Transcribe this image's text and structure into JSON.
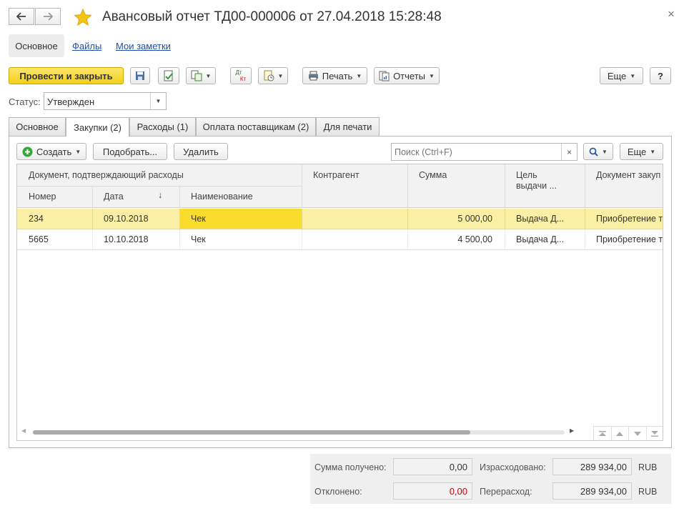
{
  "window": {
    "title": "Авансовый отчет ТД00-000006 от 27.04.2018 15:28:48",
    "close_glyph": "×"
  },
  "nav_links": {
    "main": "Основное",
    "files": "Файлы",
    "notes": "Мои заметки"
  },
  "toolbar": {
    "post_close": "Провести и закрыть",
    "print": "Печать",
    "reports": "Отчеты",
    "more": "Еще",
    "help": "?",
    "dtkt_top": "Дт",
    "dtkt_bottom": "Кт"
  },
  "status": {
    "label": "Статус:",
    "value": "Утвержден"
  },
  "tabs": [
    {
      "label": "Основное"
    },
    {
      "label": "Закупки (2)"
    },
    {
      "label": "Расходы (1)"
    },
    {
      "label": "Оплата поставщикам (2)"
    },
    {
      "label": "Для печати"
    }
  ],
  "table_toolbar": {
    "create": "Создать",
    "pick": "Подобрать...",
    "delete": "Удалить",
    "search_placeholder": "Поиск (Ctrl+F)",
    "more": "Еще"
  },
  "table": {
    "group_header": "Документ, подтверждающий расходы",
    "columns": {
      "number": "Номер",
      "date": "Дата",
      "name": "Наименование",
      "counterparty": "Контрагент",
      "sum": "Сумма",
      "purpose": "Цель выдачи ...",
      "purchase_doc": "Документ закуп"
    },
    "sort_indicator": "↓",
    "rows": [
      {
        "number": "234",
        "date": "09.10.2018",
        "name": "Чек",
        "counterparty": "",
        "sum": "5 000,00",
        "purpose": "Выдача Д...",
        "purchase_doc": "Приобретение т"
      },
      {
        "number": "5665",
        "date": "10.10.2018",
        "name": "Чек",
        "counterparty": "",
        "sum": "4 500,00",
        "purpose": "Выдача Д...",
        "purchase_doc": "Приобретение т"
      }
    ]
  },
  "totals": {
    "received_label": "Сумма получено:",
    "received_value": "0,00",
    "spent_label": "Израсходовано:",
    "spent_value": "289 934,00",
    "spent_currency": "RUB",
    "rejected_label": "Отклонено:",
    "rejected_value": "0,00",
    "overspend_label": "Перерасход:",
    "overspend_value": "289 934,00",
    "overspend_currency": "RUB"
  },
  "colors": {
    "primary_button": "#f6d92e",
    "selected_row": "#fbefa5",
    "selected_cell": "#f9dc2c",
    "star": "#f3c315",
    "negative_value": "#d20000"
  }
}
